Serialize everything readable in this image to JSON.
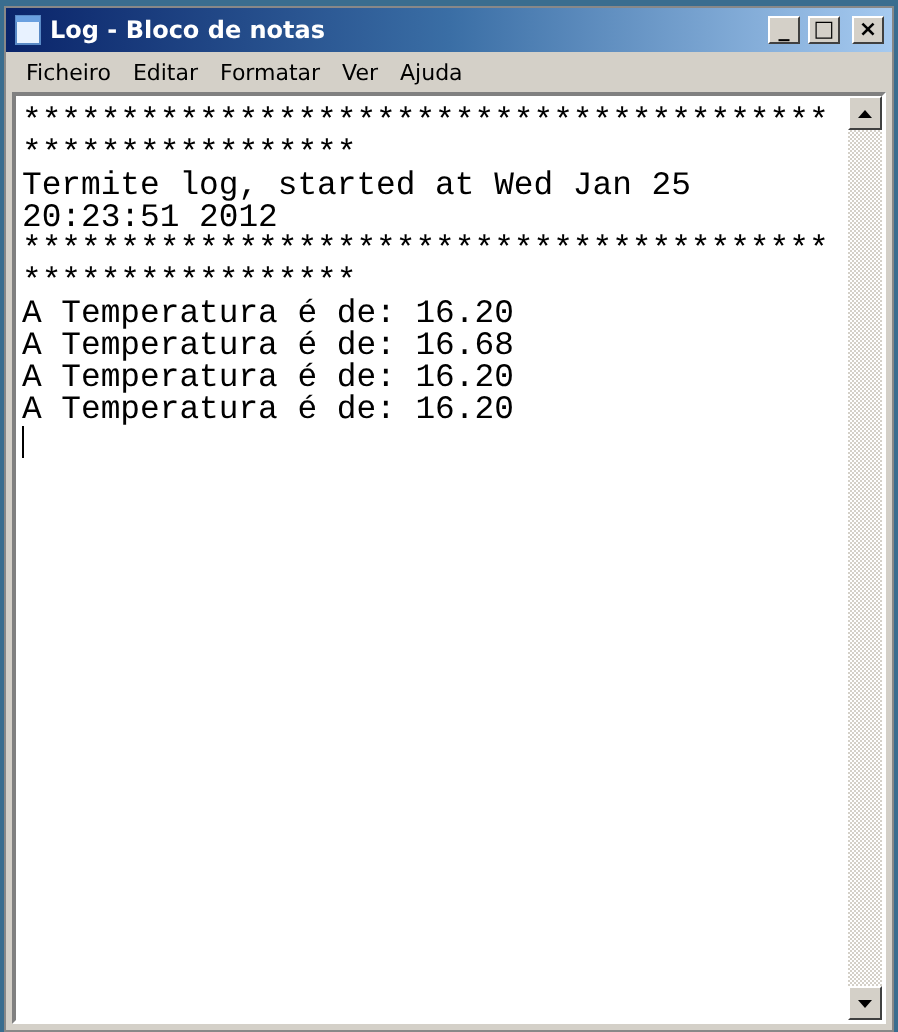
{
  "window": {
    "title": "Log - Bloco de notas",
    "controls": [
      "_",
      "□",
      "×"
    ]
  },
  "menu": [
    {
      "label": "Ficheiro"
    },
    {
      "label": "Editar"
    },
    {
      "label": "Formatar"
    },
    {
      "label": "Ver"
    },
    {
      "label": "Ajuda"
    }
  ],
  "document": {
    "lines": [
      "*****************************************",
      "*****************",
      "Termite log, started at Wed Jan 25",
      "20:23:51 2012",
      "*****************************************",
      "*****************",
      "A Temperatura é de: 16.20",
      "A Temperatura é de: 16.68",
      "A Temperatura é de: 16.20",
      "A Temperatura é de: 16.20"
    ]
  }
}
